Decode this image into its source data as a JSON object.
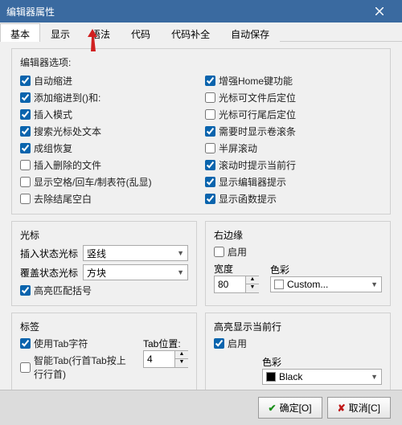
{
  "window": {
    "title": "编辑器属性"
  },
  "tabs": [
    "基本",
    "显示",
    "语法",
    "代码",
    "代码补全",
    "自动保存"
  ],
  "active_tab": 0,
  "group_options": {
    "heading": "编辑器选项:",
    "left": [
      {
        "label": "自动缩进",
        "checked": true
      },
      {
        "label": "添加缩进到()和:",
        "checked": true
      },
      {
        "label": "插入模式",
        "checked": true
      },
      {
        "label": "搜索光标处文本",
        "checked": true
      },
      {
        "label": "成组恢复",
        "checked": true
      },
      {
        "label": "插入删除的文件",
        "checked": false
      },
      {
        "label": "显示空格/回车/制表符(乱显)",
        "checked": false
      },
      {
        "label": "去除结尾空白",
        "checked": false
      }
    ],
    "right": [
      {
        "label": "增强Home键功能",
        "checked": true
      },
      {
        "label": "光标可文件后定位",
        "checked": false
      },
      {
        "label": "光标可行尾后定位",
        "checked": false
      },
      {
        "label": "需要时显示卷滚条",
        "checked": true
      },
      {
        "label": "半屏滚动",
        "checked": false
      },
      {
        "label": "滚动时提示当前行",
        "checked": true
      },
      {
        "label": "显示编辑器提示",
        "checked": true
      },
      {
        "label": "显示函数提示",
        "checked": true
      }
    ]
  },
  "cursor": {
    "heading": "光标",
    "insert_label": "插入状态光标",
    "insert_value": "竖线",
    "overwrite_label": "覆盖状态光标",
    "overwrite_value": "方块",
    "highlight_pair": {
      "label": "高亮匹配括号",
      "checked": true
    }
  },
  "margin": {
    "heading": "右边缘",
    "enable": {
      "label": "启用",
      "checked": false
    },
    "width_label": "宽度",
    "width_value": "80",
    "color_label": "色彩",
    "color_value": "Custom..."
  },
  "tab_section": {
    "heading": "标签",
    "use_tab": {
      "label": "使用Tab字符",
      "checked": true
    },
    "smart_tab": {
      "label": "智能Tab(行首Tab按上行行首)",
      "checked": false
    },
    "pos_label": "Tab位置:",
    "pos_value": "4"
  },
  "highlight_line": {
    "heading": "高亮显示当前行",
    "enable": {
      "label": "启用",
      "checked": true
    },
    "color_label": "色彩",
    "color_value": "Black"
  },
  "buttons": {
    "ok": "确定[O]",
    "cancel": "取消[C]"
  }
}
